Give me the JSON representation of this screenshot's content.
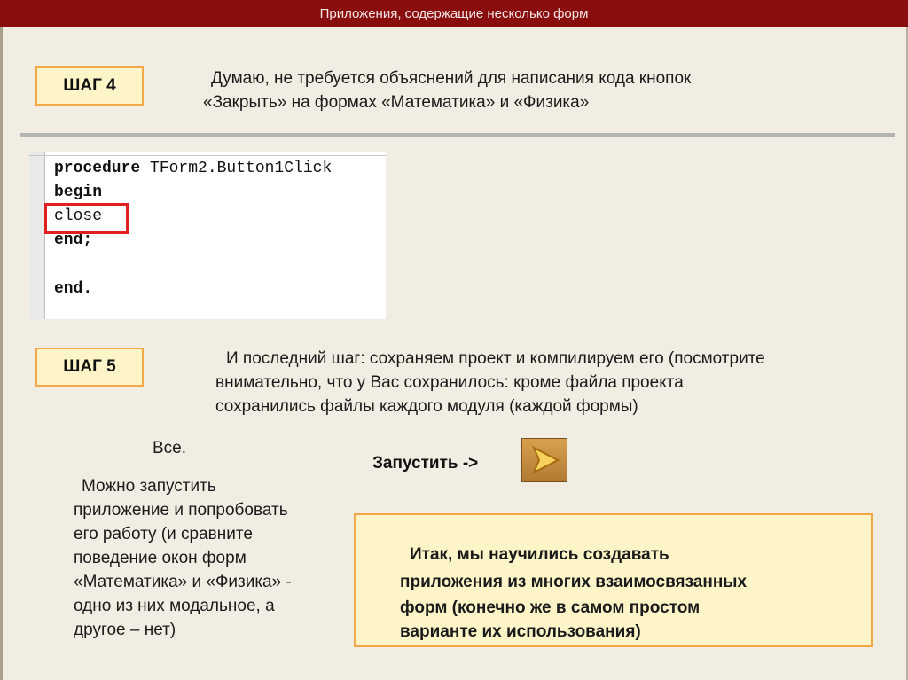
{
  "header": {
    "title": "Приложения, содержащие несколько форм"
  },
  "step4": {
    "badge": "ШАГ 4",
    "lines": [
      "Думаю, не требуется объяснений для написания кода кнопок",
      "«Закрыть» на формах «Математика» и «Физика»"
    ]
  },
  "code": {
    "lines": [
      {
        "kw": "procedure",
        "rest": " TForm2.Button1Click"
      },
      {
        "kw": "begin",
        "rest": ""
      },
      {
        "kw": "",
        "rest": "close"
      },
      {
        "kw": "end;",
        "rest": ""
      },
      {
        "kw": "end.",
        "rest": ""
      }
    ]
  },
  "step5": {
    "badge": "ШАГ 5",
    "lines": [
      "И последний шаг: сохраняем проект и компилируем его (посмотрите",
      "внимательно, что у Вас сохранилось: кроме файла проекта",
      "сохранились файлы каждого модуля (каждой формы)"
    ]
  },
  "done": {
    "title": "Все.",
    "lines": [
      "Можно запустить",
      "приложение и попробовать",
      "его работу (и сравните",
      "поведение окон форм",
      "«Математика» и «Физика» -",
      "одно из них модальное, а",
      "другое – нет)"
    ]
  },
  "run": {
    "label": "Запустить ->",
    "icon": "play-run-icon"
  },
  "summary": {
    "lines": [
      "Итак, мы научились создавать",
      "приложения из многих взаимосвязанных",
      "форм (конечно же в самом простом",
      "варианте их использования)"
    ]
  },
  "colors": {
    "header": "#8a0d0d",
    "background": "#f1ede3",
    "badge_fill": "#fdf5c7",
    "badge_border": "#f3a84a",
    "highlight": "#e02020"
  }
}
